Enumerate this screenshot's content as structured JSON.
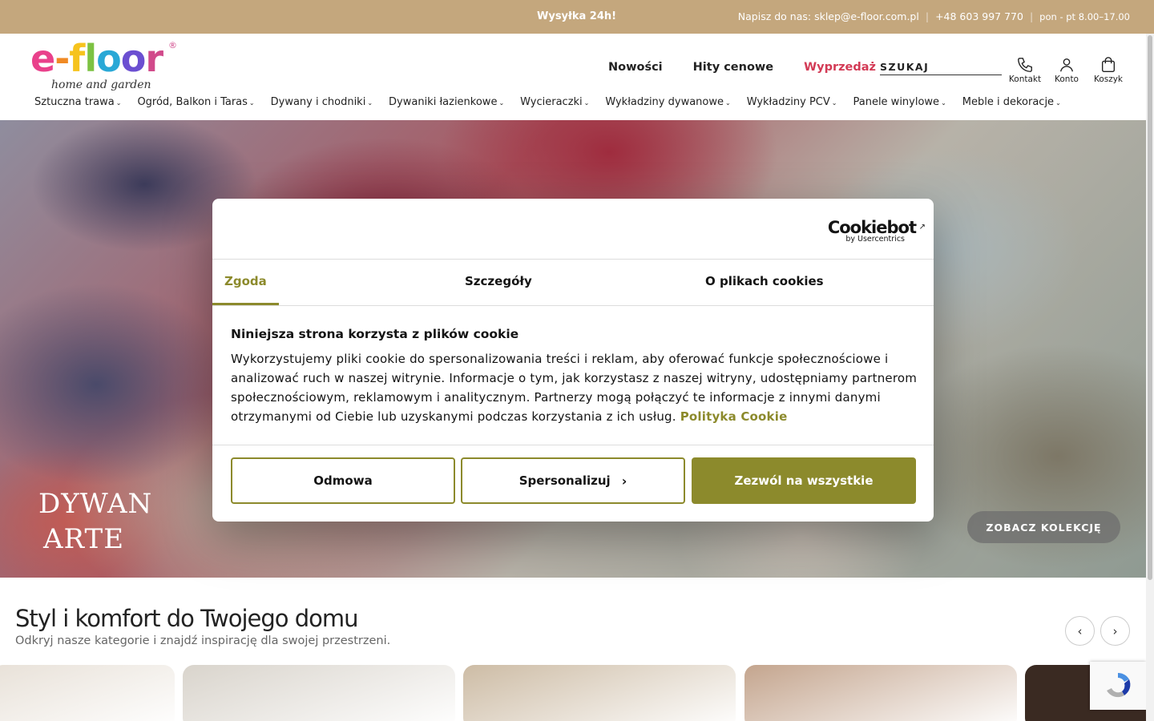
{
  "topbar": {
    "shipping": "Wysyłka 24h!",
    "email_label": "Napisz do nas: sklep@e-floor.com.pl",
    "phone": "+48 603 997 770",
    "hours": "pon - pt 8.00–17.00",
    "separator": "|"
  },
  "logo": {
    "letters": [
      "e",
      "-",
      "f",
      "l",
      "o",
      "o",
      "r"
    ],
    "reg": "®",
    "tagline": "home and garden"
  },
  "mainnav": {
    "new": "Nowości",
    "hits": "Hity cenowe",
    "sale": "Wyprzedaż"
  },
  "search": {
    "placeholder": "SZUKAJ"
  },
  "icons": {
    "contact": "Kontakt",
    "account": "Konto",
    "cart": "Koszyk"
  },
  "categories": [
    "Sztuczna trawa",
    "Ogród, Balkon i Taras",
    "Dywany i chodniki",
    "Dywaniki łazienkowe",
    "Wycieraczki",
    "Wykładziny dywanowe",
    "Wykładziny PCV",
    "Panele winylowe",
    "Meble i dekoracje"
  ],
  "hero": {
    "line1": "DYWAN",
    "line2": "ARTE",
    "cta": "ZOBACZ KOLEKCJĘ"
  },
  "section": {
    "title": "Styl i komfort do Twojego domu",
    "subtitle": "Odkryj nasze kategorie i znajdź inspirację dla swojej przestrzeni."
  },
  "arrows": {
    "prev": "‹",
    "next": "›"
  },
  "cookie": {
    "brand": "Cookiebot",
    "brand_sub": "by Usercentrics",
    "tabs": [
      "Zgoda",
      "Szczegóły",
      "O plikach cookies"
    ],
    "heading": "Niniejsza strona korzysta z plików cookie",
    "body": "Wykorzystujemy pliki cookie do spersonalizowania treści i reklam, aby oferować funkcje społecznościowe i analizować ruch w naszej witrynie. Informacje o tym, jak korzystasz z naszej witryny, udostępniamy partnerom społecznościowym, reklamowym i analitycznym. Partnerzy mogą połączyć te informacje z innymi danymi otrzymanymi od Ciebie lub uzyskanymi podczas korzystania z ich usług.",
    "policy_link": "Polityka Cookie",
    "deny": "Odmowa",
    "customize": "Spersonalizuj",
    "allow_all": "Zezwól na wszystkie"
  },
  "colors": {
    "topbar_bg": "#c4a77d",
    "sale": "#d33a55",
    "cookie_accent": "#8c8a2c",
    "logo_letters": [
      "#e9418b",
      "#f08a24",
      "#f6c31d",
      "#7cc242",
      "#2aa8d6",
      "#6b4fd1",
      "#d14a8b"
    ]
  },
  "tiles": [
    {
      "name": "tile-living-room",
      "color": "#e8e1d8"
    },
    {
      "name": "tile-kids-room",
      "color": "#d9d4cc"
    },
    {
      "name": "tile-hallway",
      "color": "#cdbca5"
    },
    {
      "name": "tile-rug-leaves",
      "color": "#c4a58e"
    },
    {
      "name": "tile-wardrobe",
      "color": "#3a2a22"
    }
  ]
}
